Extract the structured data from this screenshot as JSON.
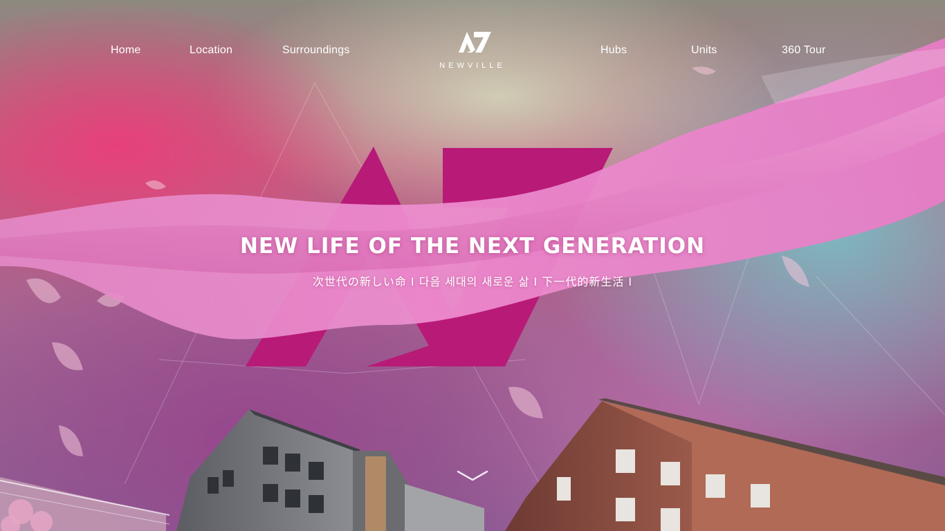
{
  "nav": {
    "left": [
      {
        "id": "home",
        "label": "Home"
      },
      {
        "id": "location",
        "label": "Location"
      },
      {
        "id": "surroundings",
        "label": "Surroundings"
      }
    ],
    "right": [
      {
        "id": "hubs",
        "label": "Hubs"
      },
      {
        "id": "units",
        "label": "Units"
      },
      {
        "id": "tour",
        "label": "360 Tour"
      }
    ]
  },
  "brand": {
    "logo_icon": "a7-logo-icon",
    "name": "NEWVILLE"
  },
  "hero": {
    "big_mark_icon": "a7-monogram-icon",
    "headline": "NEW LIFE OF THE NEXT GENERATION",
    "subline": "次世代の新しい命  I   다음 세대의 새로운 삶 I   下一代的新生活  I",
    "scroll_icon": "chevron-down-icon"
  },
  "colors": {
    "accent_magenta": "#b81a78",
    "ribbon_pink": "#ea7cc4",
    "text": "#ffffff"
  }
}
